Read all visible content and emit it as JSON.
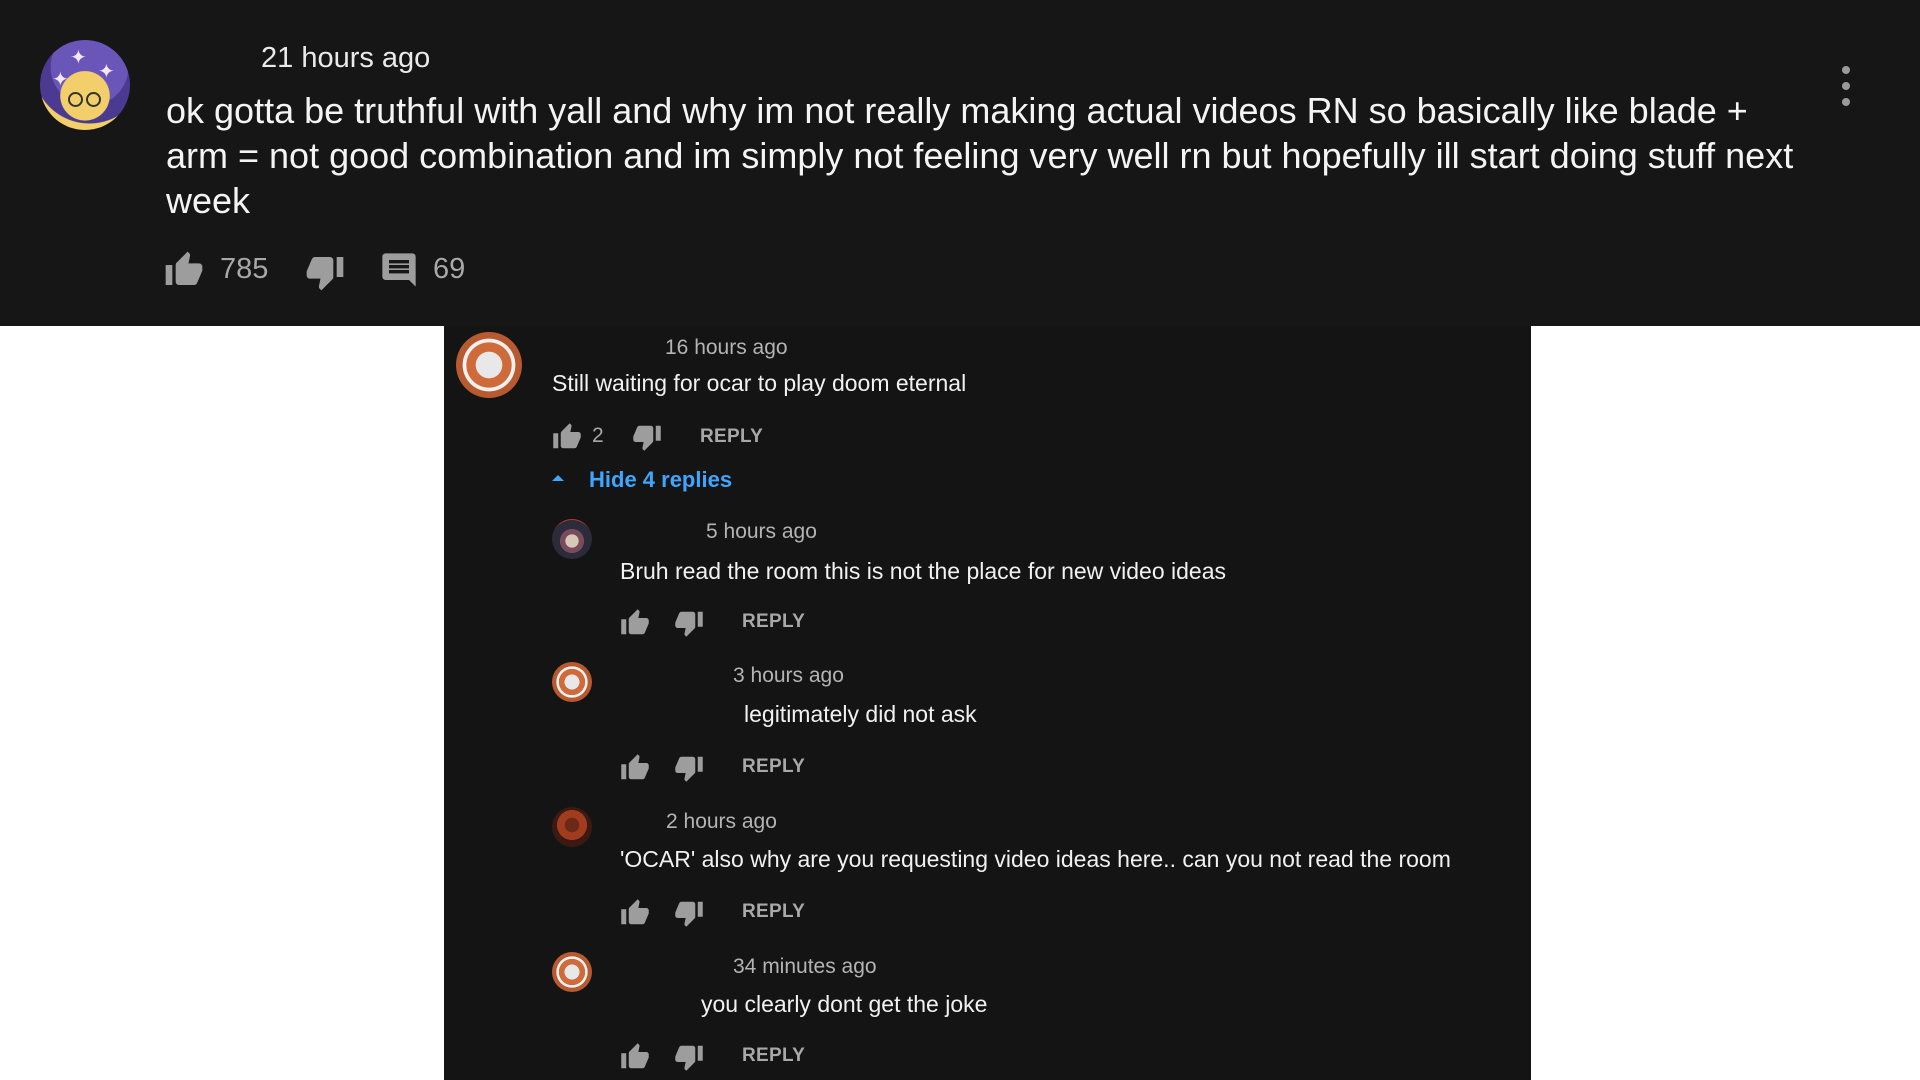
{
  "post": {
    "timestamp": "21 hours ago",
    "text": "ok gotta be truthful with yall and why im not really making actual videos RN so basically like blade + arm = not good combination and im simply not feeling very well rn but hopefully ill start doing stuff next week",
    "likes": "785",
    "comments": "69"
  },
  "thread": {
    "comment": {
      "timestamp": "16 hours ago",
      "text": "Still waiting for ocar to play doom eternal",
      "likes": "2",
      "reply_label": "REPLY"
    },
    "toggle_label": "Hide 4 replies",
    "replies": [
      {
        "timestamp": "5 hours ago",
        "text": "Bruh read the room this is not the place for new video ideas",
        "reply_label": "REPLY"
      },
      {
        "timestamp": "3 hours ago",
        "text": "legitimately did not ask",
        "reply_label": "REPLY"
      },
      {
        "timestamp": "2 hours ago",
        "text": "'OCAR' also why are you requesting video ideas here.. can you not read the room",
        "reply_label": "REPLY"
      },
      {
        "timestamp": "34 minutes ago",
        "text": "you clearly dont get the joke",
        "reply_label": "REPLY"
      }
    ]
  },
  "colors": {
    "post_bg": "#161616",
    "thread_bg": "#141414",
    "link": "#3ea6ff",
    "page_bg": "#ffffff"
  }
}
